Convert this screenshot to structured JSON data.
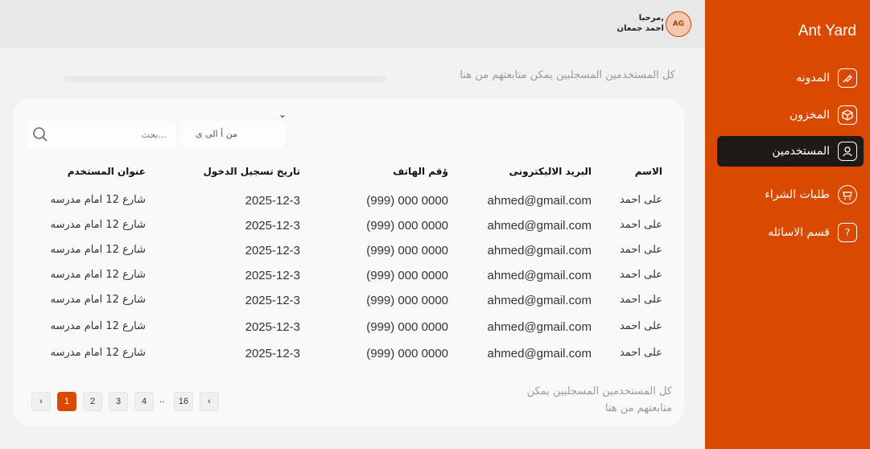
{
  "sidebar": {
    "brand": "Ant Yard",
    "items": [
      {
        "label": "المدونه",
        "icon": "blog-icon"
      },
      {
        "label": "المخزون",
        "icon": "box-icon"
      },
      {
        "label": "المستخدمين",
        "icon": "user-icon",
        "active": true
      },
      {
        "label": "طلبات الشراء",
        "icon": "cart-icon"
      },
      {
        "label": "قسم الاسائله",
        "icon": "question-icon"
      }
    ]
  },
  "header": {
    "avatar_initials": "AG",
    "greeting": "مرحبا,",
    "user_name": "احمد جمعان"
  },
  "main": {
    "subtitle": "كل المستخدمين المسجلبين يمكن متابعتهم من هنا",
    "search_placeholder": "بحث...",
    "sort_label": "من أ الى ى",
    "footer_line1": "كل المستخدمين المسجلبين يمكن",
    "footer_line2": "متابعتهم من هنا"
  },
  "table": {
    "headers": {
      "name": "الاسم",
      "email": "البريد الاليكترونى",
      "phone": "ؤقم الهاتف",
      "date": "تاريخ تسجيل الدخول",
      "address": "عنوان المستخدم"
    },
    "rows": [
      {
        "name": "على احمد",
        "email": "ahmed@gmail.com",
        "phone": "(999) 000  0000",
        "date": "2025-12-3",
        "address": "شارع 12 امام مدرسه"
      },
      {
        "name": "على احمد",
        "email": "ahmed@gmail.com",
        "phone": "(999) 000  0000",
        "date": "2025-12-3",
        "address": "شارع 12 امام مدرسه"
      },
      {
        "name": "على احمد",
        "email": "ahmed@gmail.com",
        "phone": "(999) 000  0000",
        "date": "2025-12-3",
        "address": "شارع 12 امام مدرسه"
      },
      {
        "name": "على احمد",
        "email": "ahmed@gmail.com",
        "phone": "(999) 000  0000",
        "date": "2025-12-3",
        "address": "شارع 12 امام مدرسه"
      },
      {
        "name": "على احمد",
        "email": "ahmed@gmail.com",
        "phone": "(999) 000  0000",
        "date": "2025-12-3",
        "address": "شارع 12 امام مدرسه"
      },
      {
        "name": "على احمد",
        "email": "ahmed@gmail.com",
        "phone": "(999) 000  0000",
        "date": "2025-12-3",
        "address": "شارع 12 امام مدرسه"
      },
      {
        "name": "على احمد",
        "email": "ahmed@gmail.com",
        "phone": "(999) 000  0000",
        "date": "2025-12-3",
        "address": "شارع 12 امام مدرسه"
      }
    ]
  },
  "pagination": {
    "prev": "‹",
    "next": "›",
    "pages": [
      "16",
      "4",
      "3",
      "2",
      "1"
    ],
    "ellipsis": "..",
    "current": "1"
  },
  "colors": {
    "accent": "#d94a00",
    "active_nav": "#1e1a18"
  }
}
